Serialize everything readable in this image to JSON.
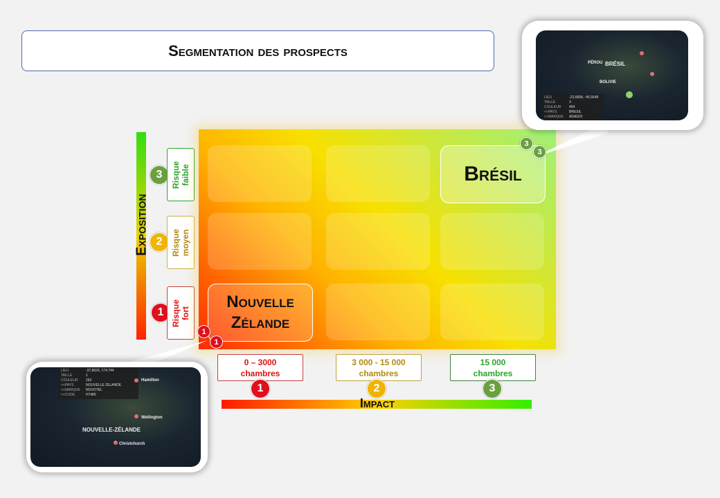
{
  "title": "Segmentation des prospects",
  "y_axis": {
    "label": "Exposition",
    "levels": [
      {
        "badge": "3",
        "text": "Risque\nfaible",
        "color": "#2aa52a",
        "badge_color": "green"
      },
      {
        "badge": "2",
        "text": "Risque\nmoyen",
        "color": "#b08a10",
        "badge_color": "yellow"
      },
      {
        "badge": "1",
        "text": "Risque\nfort",
        "color": "#e01010",
        "badge_color": "red"
      }
    ]
  },
  "x_axis": {
    "label": "Impact",
    "levels": [
      {
        "badge": "1",
        "line1": "0 – 3000",
        "line2": "chambres",
        "color": "#e01010",
        "border": "#c04040"
      },
      {
        "badge": "2",
        "line1": "3 000 - 15 000",
        "line2": "chambres",
        "color": "#b08a10",
        "border": "#c0a040"
      },
      {
        "badge": "3",
        "line1": "15 000",
        "line2": "chambres",
        "color": "#2aa52a",
        "border": "#408040"
      }
    ]
  },
  "cells": {
    "bresil": {
      "label": "Brésil",
      "badges": [
        "3",
        "3"
      ]
    },
    "nz": {
      "label_line1": "Nouvelle",
      "label_line2": "Zélande",
      "badges": [
        "1",
        "1"
      ]
    }
  },
  "map_bresil": {
    "country": "BRÉSIL",
    "other_labels": [
      "PÉROU",
      "BOLIVIE"
    ],
    "popup": [
      {
        "k": "LIEU",
        "v": "-23,6898, -46,5648"
      },
      {
        "k": "TAILLE",
        "v": "3"
      },
      {
        "k": "COULEUR",
        "v": "464"
      },
      {
        "k": "<<PAYS",
        "v": "BRESIL"
      },
      {
        "k": "<<MARQUE",
        "v": "ADAGIO"
      }
    ]
  },
  "map_nz": {
    "country": "NOUVELLE-ZÉLANDE",
    "cities": [
      "Hamilton",
      "Wellington",
      "Christchurch"
    ],
    "popup": [
      {
        "k": "LIEU",
        "v": "-37,8026, 174,744"
      },
      {
        "k": "TAILLE",
        "v": "1"
      },
      {
        "k": "COULEUR",
        "v": "263"
      },
      {
        "k": "<<PAYS",
        "v": "NOUVELLE ZELANDE"
      },
      {
        "k": "<<MARQUE",
        "v": "NOVOTEL"
      },
      {
        "k": "<<CODE",
        "v": "H7485"
      }
    ]
  }
}
